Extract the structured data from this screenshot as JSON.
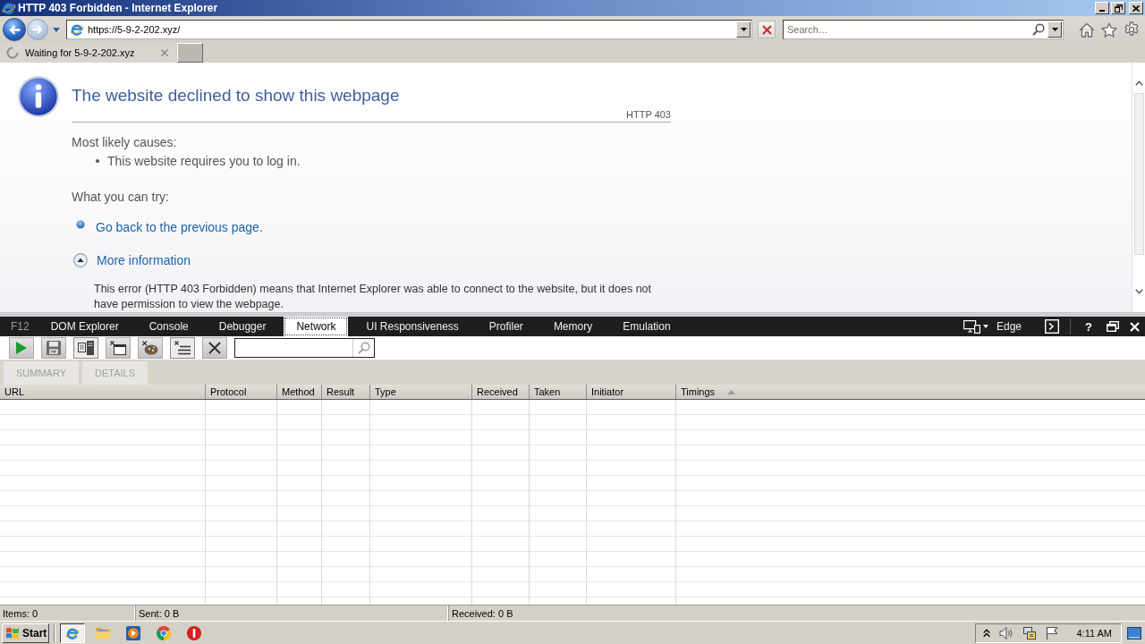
{
  "window": {
    "title": "HTTP 403 Forbidden - Internet Explorer"
  },
  "navigation": {
    "address": "https://5-9-2-202.xyz/",
    "search": {
      "placeholder": "Search…"
    }
  },
  "tabs": [
    {
      "label": "Waiting for 5-9-2-202.xyz",
      "selected": true
    }
  ],
  "page": {
    "heading": "The website declined to show this webpage",
    "code": "HTTP 403",
    "causes_title": "Most likely causes:",
    "causes": [
      "This website requires you to log in."
    ],
    "try_title": "What you can try:",
    "actions": [
      {
        "kind": "link",
        "label": "Go back to the previous page."
      },
      {
        "kind": "expander",
        "label": "More information",
        "expanded": true
      }
    ],
    "details": "This error (HTTP 403 Forbidden) means that Internet Explorer was able to connect to the website, but it does not have permission to view the webpage."
  },
  "devtools": {
    "label": "F12",
    "tabs": [
      {
        "label": "DOM Explorer",
        "selected": false
      },
      {
        "label": "Console",
        "selected": false
      },
      {
        "label": "Debugger",
        "selected": false
      },
      {
        "label": "Network",
        "selected": true
      },
      {
        "label": "UI Responsiveness",
        "selected": false
      },
      {
        "label": "Profiler",
        "selected": false
      },
      {
        "label": "Memory",
        "selected": false
      },
      {
        "label": "Emulation",
        "selected": false
      }
    ],
    "mode": "Edge",
    "help": "?",
    "toolbar": [
      {
        "kind": "play",
        "pressed": false
      },
      {
        "kind": "save",
        "pressed": false
      },
      {
        "kind": "server",
        "pressed": true
      },
      {
        "kind": "window-clear",
        "pressed": false
      },
      {
        "kind": "cookie-clear",
        "pressed": false
      },
      {
        "kind": "list-clear",
        "pressed": true
      },
      {
        "kind": "delete",
        "pressed": false
      }
    ],
    "views": [
      {
        "label": "SUMMARY",
        "disabled": true
      },
      {
        "label": "DETAILS",
        "disabled": true
      }
    ],
    "columns": [
      {
        "label": "URL"
      },
      {
        "label": "Protocol"
      },
      {
        "label": "Method"
      },
      {
        "label": "Result"
      },
      {
        "label": "Type"
      },
      {
        "label": "Received"
      },
      {
        "label": "Taken"
      },
      {
        "label": "Initiator"
      },
      {
        "label": "Timings",
        "sort_ascending": true
      }
    ],
    "status_bar": [
      "Items: 0",
      "Sent: 0 B",
      "Received: 0 B"
    ]
  },
  "taskbar": {
    "start": "Start",
    "apps": [
      {
        "kind": "browser",
        "selected": true
      },
      {
        "kind": "folder",
        "selected": false
      },
      {
        "kind": "media",
        "selected": false
      },
      {
        "kind": "globe",
        "selected": false
      },
      {
        "kind": "alert",
        "selected": false
      }
    ],
    "clock": "4:11 AM"
  }
}
